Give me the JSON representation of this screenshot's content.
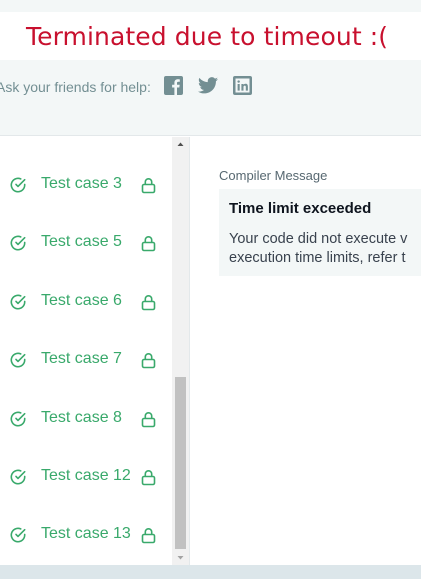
{
  "status": {
    "title": "Terminated due to timeout :("
  },
  "share": {
    "label": "Ask your friends for help:",
    "icons": [
      "facebook-icon",
      "twitter-icon",
      "linkedin-icon"
    ],
    "icon_color": "#738f93"
  },
  "test_cases": [
    {
      "label": "Test case 3",
      "status": "passed",
      "locked": true
    },
    {
      "label": "Test case 5",
      "status": "passed",
      "locked": true
    },
    {
      "label": "Test case 6",
      "status": "passed",
      "locked": true
    },
    {
      "label": "Test case 7",
      "status": "passed",
      "locked": true
    },
    {
      "label": "Test case 8",
      "status": "passed",
      "locked": true
    },
    {
      "label": "Test case 12",
      "status": "passed",
      "locked": true
    },
    {
      "label": "Test case 13",
      "status": "passed",
      "locked": true
    }
  ],
  "compiler": {
    "label": "Compiler Message",
    "message_title": "Time limit exceeded",
    "message_line1": "Your code did not execute v",
    "message_line2": "execution time limits, refer t"
  },
  "colors": {
    "title_red": "#c8102e",
    "pass_green": "#39a96b",
    "panel_bg": "#f3f7f7"
  }
}
